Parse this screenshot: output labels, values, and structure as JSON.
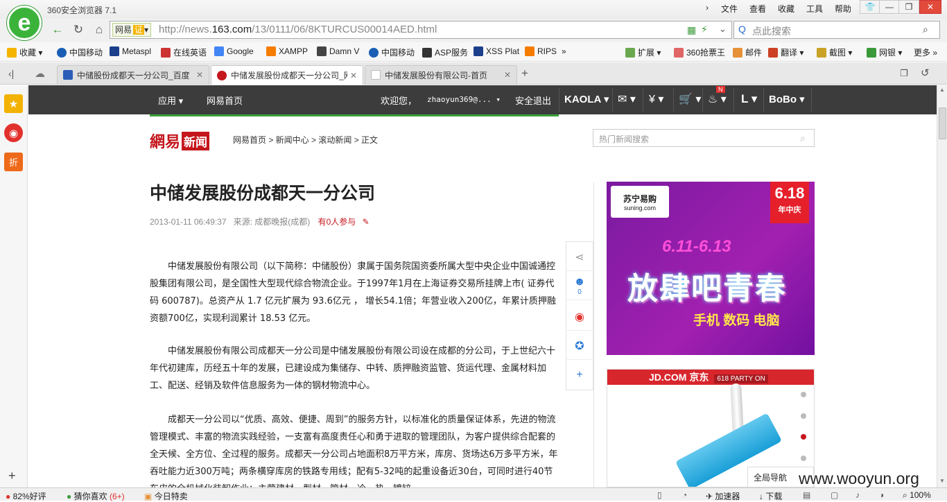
{
  "browser": {
    "app_title": "360安全浏览器 7.1",
    "menu": [
      "文件",
      "查看",
      "收藏",
      "工具",
      "帮助"
    ],
    "site_badge": "网易",
    "site_badge_cert": "证",
    "url_prefix": "http://news.",
    "url_domain": "163.com",
    "url_path": "/13/0111/06/8KTURCUS00014AED.html",
    "search_placeholder": "点此搜索"
  },
  "bookmarks": {
    "left": [
      "收藏",
      "中国移动",
      "Metaspl",
      "在线英语",
      "Google",
      "XAMPP",
      "Damn V",
      "中国移动",
      "ASP服务",
      "XSS Plat",
      "RIPS"
    ],
    "right": [
      "扩展",
      "360抢票王",
      "邮件",
      "翻译",
      "截图",
      "网银",
      "更多"
    ]
  },
  "tabs": [
    {
      "label": "中储股份成都天一分公司_百度"
    },
    {
      "label": "中储发展股份成都天一分公司_网"
    },
    {
      "label": "中储发展股份有限公司-首页"
    }
  ],
  "site_nav": {
    "apps": "应用",
    "home": "网易首页",
    "welcome": "欢迎您，",
    "user": "zhaoyun369@...",
    "logout": "安全退出",
    "kaola": "KAOLA",
    "bobo": "BoBo",
    "badge": "N"
  },
  "brand": {
    "wy": "網易",
    "xw": "新闻"
  },
  "breadcrumb": "网易首页 > 新闻中心 > 滚动新闻 > 正文",
  "news_search_placeholder": "热门新闻搜索",
  "article": {
    "title": "中储发展股份成都天一分公司",
    "date": "2013-01-11 06:49:37",
    "source": "来源: 成都晚报(成都)",
    "comments": "有0人参与",
    "paragraphs": [
      "中储发展股份有限公司（以下简称：中储股份）隶属于国务院国资委所属大型中央企业中国诚通控股集团有限公司，是全国性大型现代综合物流企业。于1997年1月在上海证券交易所挂牌上市( 证券代码 600787)。总资产从 1.7 亿元扩展为 93.6亿元 ， 增长54.1倍；年营业收入200亿，年累计质押融资额700亿，实现利润累计 18.53 亿元。",
      "中储发展股份有限公司成都天一分公司是中储发展股份有限公司设在成都的分公司，于上世纪六十年代初建库，历经五十年的发展，已建设成为集储存、中转、质押融资监管、货运代理、金属材料加工、配送、经销及软件信息服务为一体的钢材物流中心。",
      "成都天一分公司以“优质、高效、便捷、周到”的服务方针，以标准化的质量保证体系，先进的物流管理模式、丰富的物流实践经验，一支富有高度责任心和勇于进取的管理团队，为客户提供综合配套的全天候、全方位、全过程的服务。成都天一分公司占地面积8万平方米，库房、货场达6万多平方米，年吞吐能力近300万吨；两条横穿库房的铁路专用线；配有5-32吨的起重设备近30台，可同时进行40节车皮的全机械化装卸作业；主营建材、型材、管材、冷、热、镀锌"
    ]
  },
  "share_count": "0",
  "ad1": {
    "logo": "苏宁易购",
    "logo_en": "suning.com",
    "badge": "6.18",
    "badge_sub": "年中庆",
    "date": "6.11-6.13",
    "slogan": "放肆吧青春",
    "sub": "手机  数码  电脑"
  },
  "ad2": {
    "head": "JD.COM 京东",
    "tag": "618 PARTY ON"
  },
  "global_nav": "全局导航",
  "watermark": "www.wooyun.org",
  "status": {
    "rating": "82%好评",
    "guess": "猜你喜欢",
    "guess_count": "(6+)",
    "deals": "今日特卖",
    "accelerator": "加速器",
    "download": "下载",
    "zoom": "100%"
  },
  "colors": {
    "netease_red": "#c4161c",
    "nav_dark": "#3c3c3c",
    "logo_green": "#3bb33b"
  }
}
